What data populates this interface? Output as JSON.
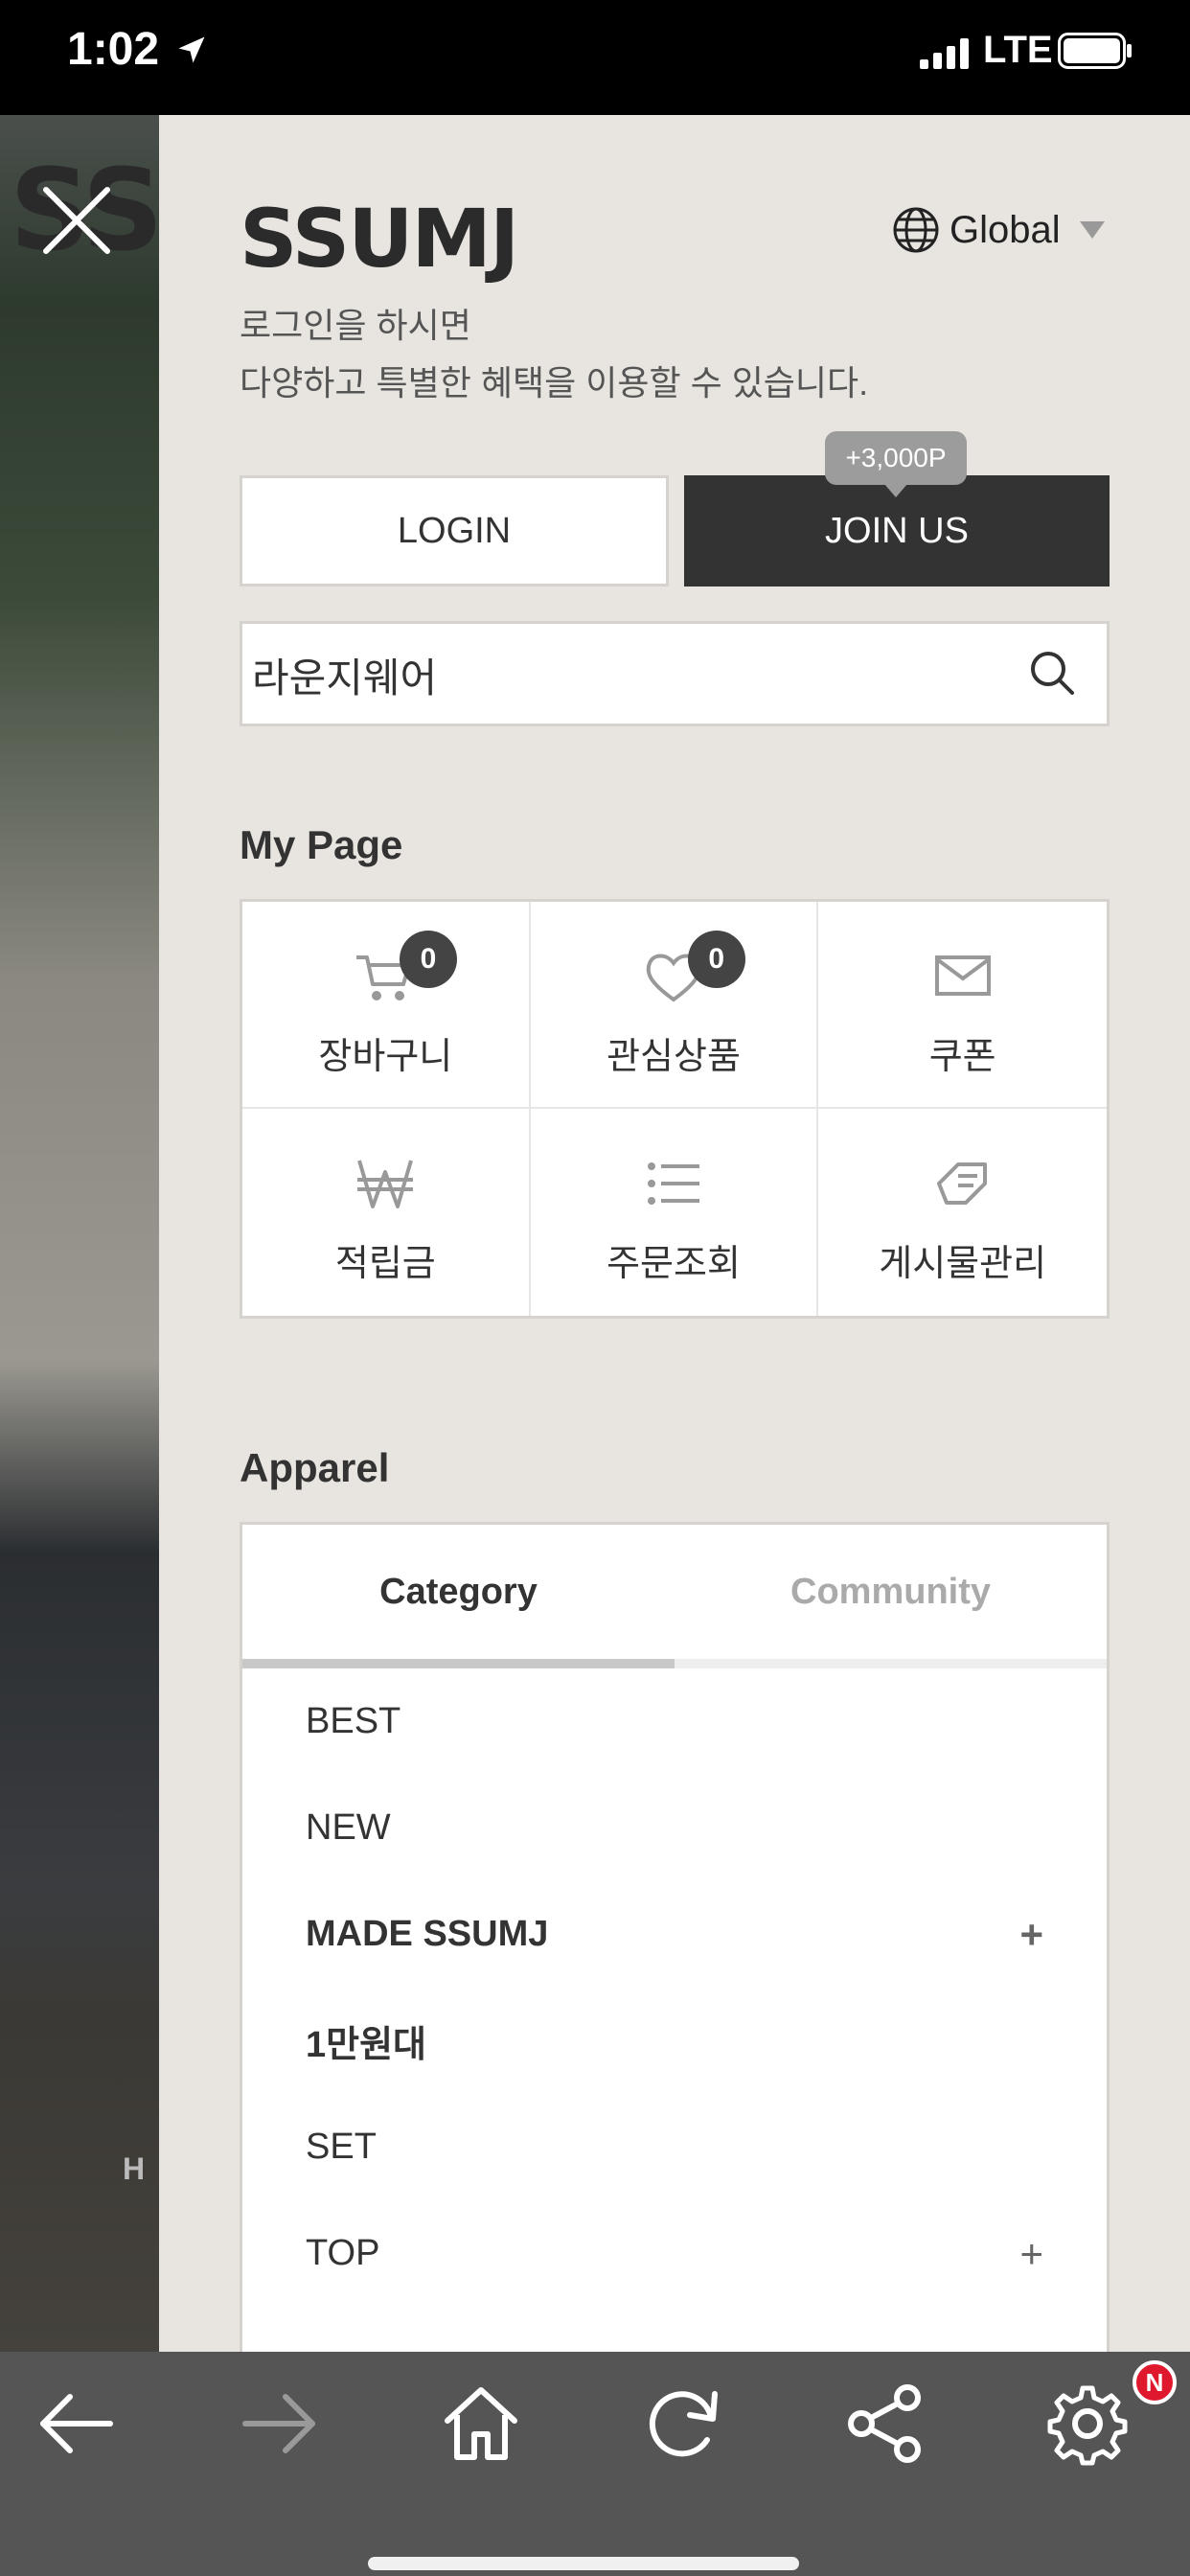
{
  "status_bar": {
    "time": "1:02",
    "network": "LTE"
  },
  "background": {
    "logo_text": "SSU",
    "partial_text": "H"
  },
  "drawer": {
    "brand": "SSUMJ",
    "language": "Global",
    "intro_line1": "로그인을 하시면",
    "intro_line2": "다양하고 특별한 혜택을 이용할 수 있습니다.",
    "login_label": "LOGIN",
    "join_label": "JOIN US",
    "join_bonus": "+3,000P",
    "search_value": "라운지웨어",
    "mypage_title": "My Page",
    "mypage_items": [
      {
        "label": "장바구니",
        "icon": "cart-icon",
        "badge": "0"
      },
      {
        "label": "관심상품",
        "icon": "heart-icon",
        "badge": "0"
      },
      {
        "label": "쿠폰",
        "icon": "envelope-icon"
      },
      {
        "label": "적립금",
        "icon": "won-icon"
      },
      {
        "label": "주문조회",
        "icon": "list-icon"
      },
      {
        "label": "게시물관리",
        "icon": "board-icon"
      }
    ],
    "apparel_title": "Apparel",
    "tabs": [
      {
        "label": "Category",
        "active": true
      },
      {
        "label": "Community",
        "active": false
      }
    ],
    "categories": [
      {
        "label": "BEST",
        "bold": false,
        "expandable": false
      },
      {
        "label": "NEW",
        "bold": false,
        "expandable": false
      },
      {
        "label": "MADE SSUMJ",
        "bold": true,
        "expandable": true
      },
      {
        "label": "1만원대",
        "bold": true,
        "expandable": false
      },
      {
        "label": "SET",
        "bold": false,
        "expandable": false
      },
      {
        "label": "TOP",
        "bold": false,
        "expandable": true
      }
    ],
    "expand_symbol": "+"
  },
  "toolbar": {
    "icons": [
      "back-icon",
      "forward-icon",
      "home-icon",
      "refresh-icon",
      "share-icon",
      "settings-icon"
    ],
    "notification_badge": "N"
  },
  "colors": {
    "drawer_bg": "#e8e5e0",
    "dark": "#333333",
    "toolbar": "#555555",
    "badge_red": "#e0182d"
  }
}
